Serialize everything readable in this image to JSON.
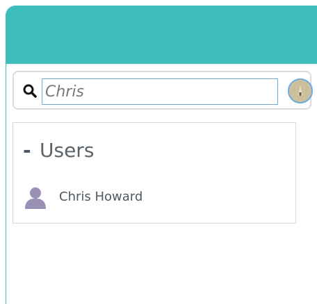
{
  "search": {
    "query": "Chris"
  },
  "results": {
    "toggle_symbol": "-",
    "section_title": "Users",
    "users": [
      {
        "name": "Chris Howard"
      }
    ]
  },
  "colors": {
    "header": "#3dbdbd",
    "focus_border": "#6aa8de",
    "user_icon": "#9a8fb4"
  }
}
